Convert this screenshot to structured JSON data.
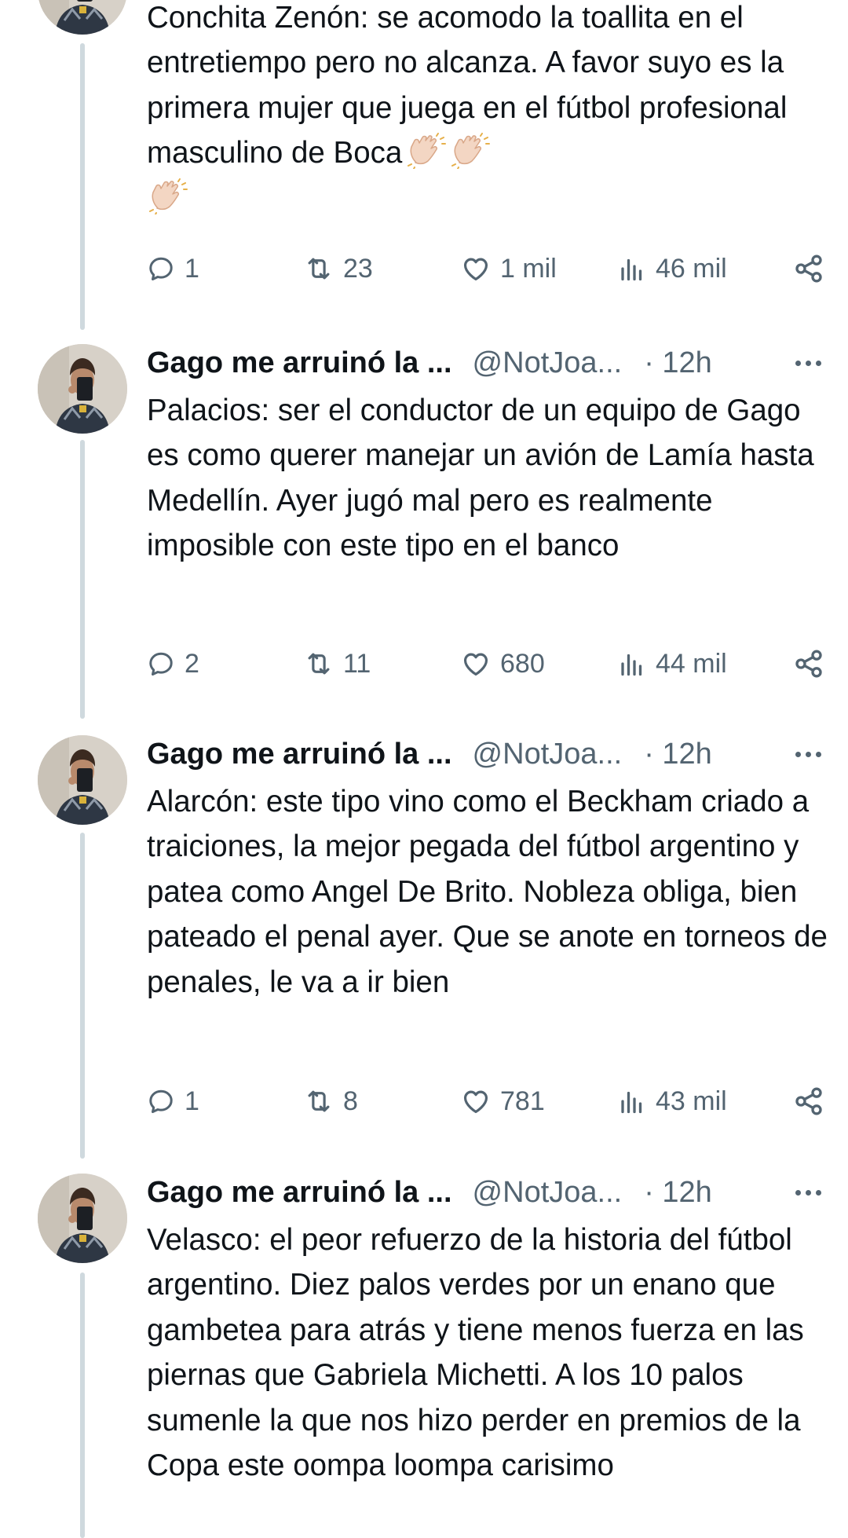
{
  "tweets": [
    {
      "text": "Conchita Zenón: se acomodo la toallita en el entretiempo pero no alcanza. A favor suyo es la primera mujer que juega en el fútbol profesional masculino de Boca",
      "emoji": "👏🏻👏🏻👏🏻",
      "replies": "1",
      "retweets": "23",
      "likes": "1 mil",
      "views": "46 mil"
    },
    {
      "author": "Gago me arruinó la ...",
      "handle": "@NotJoa...",
      "time": "· 12h",
      "text": "Palacios: ser el conductor de un equipo de Gago es como querer manejar un avión de Lamía hasta Medellín. Ayer jugó mal pero es realmente imposible con este tipo en el banco",
      "replies": "2",
      "retweets": "11",
      "likes": "680",
      "views": "44 mil"
    },
    {
      "author": "Gago me arruinó la ...",
      "handle": "@NotJoa...",
      "time": "· 12h",
      "text": "Alarcón: este tipo vino como el Beckham criado a traiciones, la mejor pegada del fútbol argentino y patea como Angel De Brito. Nobleza obliga, bien pateado el penal ayer. Que se anote en torneos de penales, le va a ir bien",
      "replies": "1",
      "retweets": "8",
      "likes": "781",
      "views": "43 mil"
    },
    {
      "author": "Gago me arruinó la ...",
      "handle": "@NotJoa...",
      "time": "· 12h",
      "text": "Velasco: el peor refuerzo de la historia del fútbol argentino. Diez palos verdes por un enano que gambetea para atrás y tiene menos fuerza en las piernas que Gabriela Michetti. A los 10 palos sumenle la que nos hizo perder en premios de la Copa este oompa loompa carisimo"
    }
  ],
  "colors": {
    "text": "#0f1419",
    "secondary": "#536471",
    "thread_line": "#cfd9de"
  }
}
